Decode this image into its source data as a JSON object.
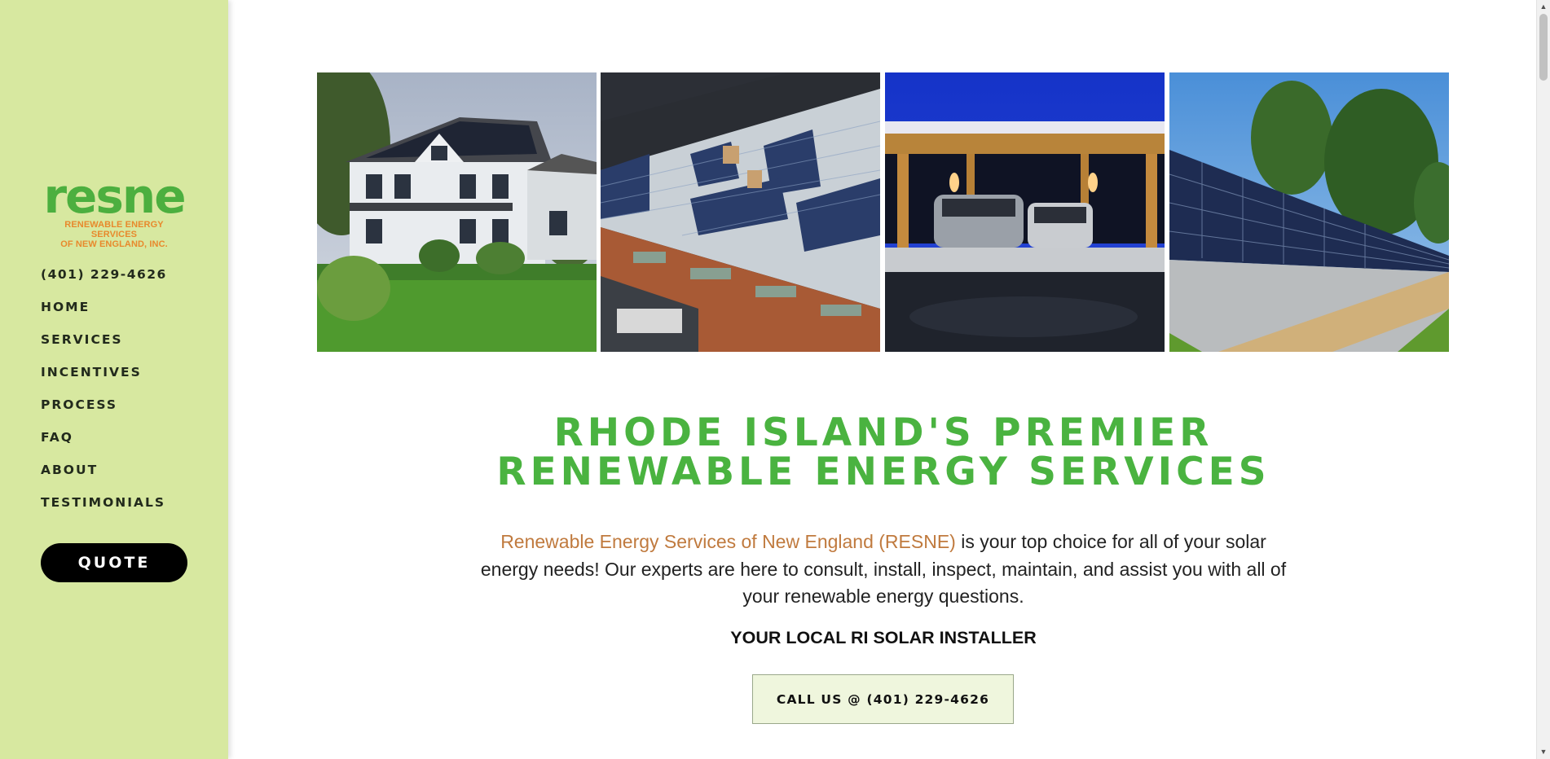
{
  "sidebar": {
    "logo": {
      "mark": "resne",
      "subtitle_line1": "RENEWABLE ENERGY SERVICES",
      "subtitle_line2": "OF NEW ENGLAND, INC."
    },
    "nav": [
      {
        "label": "(401) 229-4626"
      },
      {
        "label": "HOME"
      },
      {
        "label": "SERVICES"
      },
      {
        "label": "INCENTIVES"
      },
      {
        "label": "PROCESS"
      },
      {
        "label": "FAQ"
      },
      {
        "label": "ABOUT"
      },
      {
        "label": "TESTIMONIALS"
      }
    ],
    "quote_label": "QUOTE"
  },
  "gallery": [
    {
      "subject": "house-with-rooftop-solar"
    },
    {
      "subject": "commercial-rooftop-solar"
    },
    {
      "subject": "solar-carport-at-night"
    },
    {
      "subject": "ground-mount-solar-array"
    }
  ],
  "hero": {
    "headline_line1": "RHODE ISLAND'S PREMIER",
    "headline_line2": "RENEWABLE ENERGY SERVICES",
    "intro_brand": "Renewable Energy Services of New England (RESNE)",
    "intro_rest": " is your top choice for all of your solar energy needs! Our experts are here to consult, install, inspect, maintain, and assist you with all of your renewable energy questions.",
    "subheading": "YOUR LOCAL RI SOLAR INSTALLER",
    "call_label": "CALL US @ (401) 229-4626"
  },
  "colors": {
    "sidebar_bg": "#d7e8a0",
    "brand_green": "#4ab340",
    "brand_orange": "#e8892c",
    "link_brown": "#c07a3e",
    "call_button_bg": "#eff6dd"
  }
}
